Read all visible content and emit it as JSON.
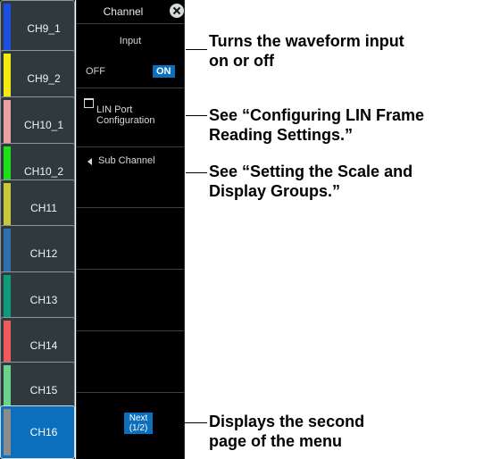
{
  "channels": [
    {
      "label": "CH9_1",
      "color": "#1f4fe0"
    },
    {
      "label": "CH9_2",
      "color": "#f5ea10"
    },
    {
      "label": "CH10_1",
      "color": "#e9a1a6"
    },
    {
      "label": "CH10_2",
      "color": "#1ee016"
    },
    {
      "label": "CH11",
      "color": "#c8c83a"
    },
    {
      "label": "CH12",
      "color": "#2f6fb0"
    },
    {
      "label": "CH13",
      "color": "#0f9a7a"
    },
    {
      "label": "CH14",
      "color": "#f05a5a"
    },
    {
      "label": "CH15",
      "color": "#6ed38a"
    },
    {
      "label": "CH16",
      "color": "#8c8c8c"
    }
  ],
  "active_channel": "CH16",
  "panel": {
    "title": "Channel",
    "input": {
      "label": "Input",
      "off_label": "OFF",
      "on_label": "ON",
      "state": "ON"
    },
    "lin_port": {
      "label": "LIN Port\nConfiguration"
    },
    "sub_channel": {
      "label": "Sub Channel"
    },
    "next": {
      "line1": "Next",
      "line2": "(1/2)"
    }
  },
  "callouts": {
    "input": "Turns the waveform input\non or off",
    "lin": "See “Configuring LIN Frame\nReading Settings.”",
    "sub": "See “Setting the Scale and\nDisplay Groups.”",
    "next": "Displays the second\npage of the menu"
  }
}
